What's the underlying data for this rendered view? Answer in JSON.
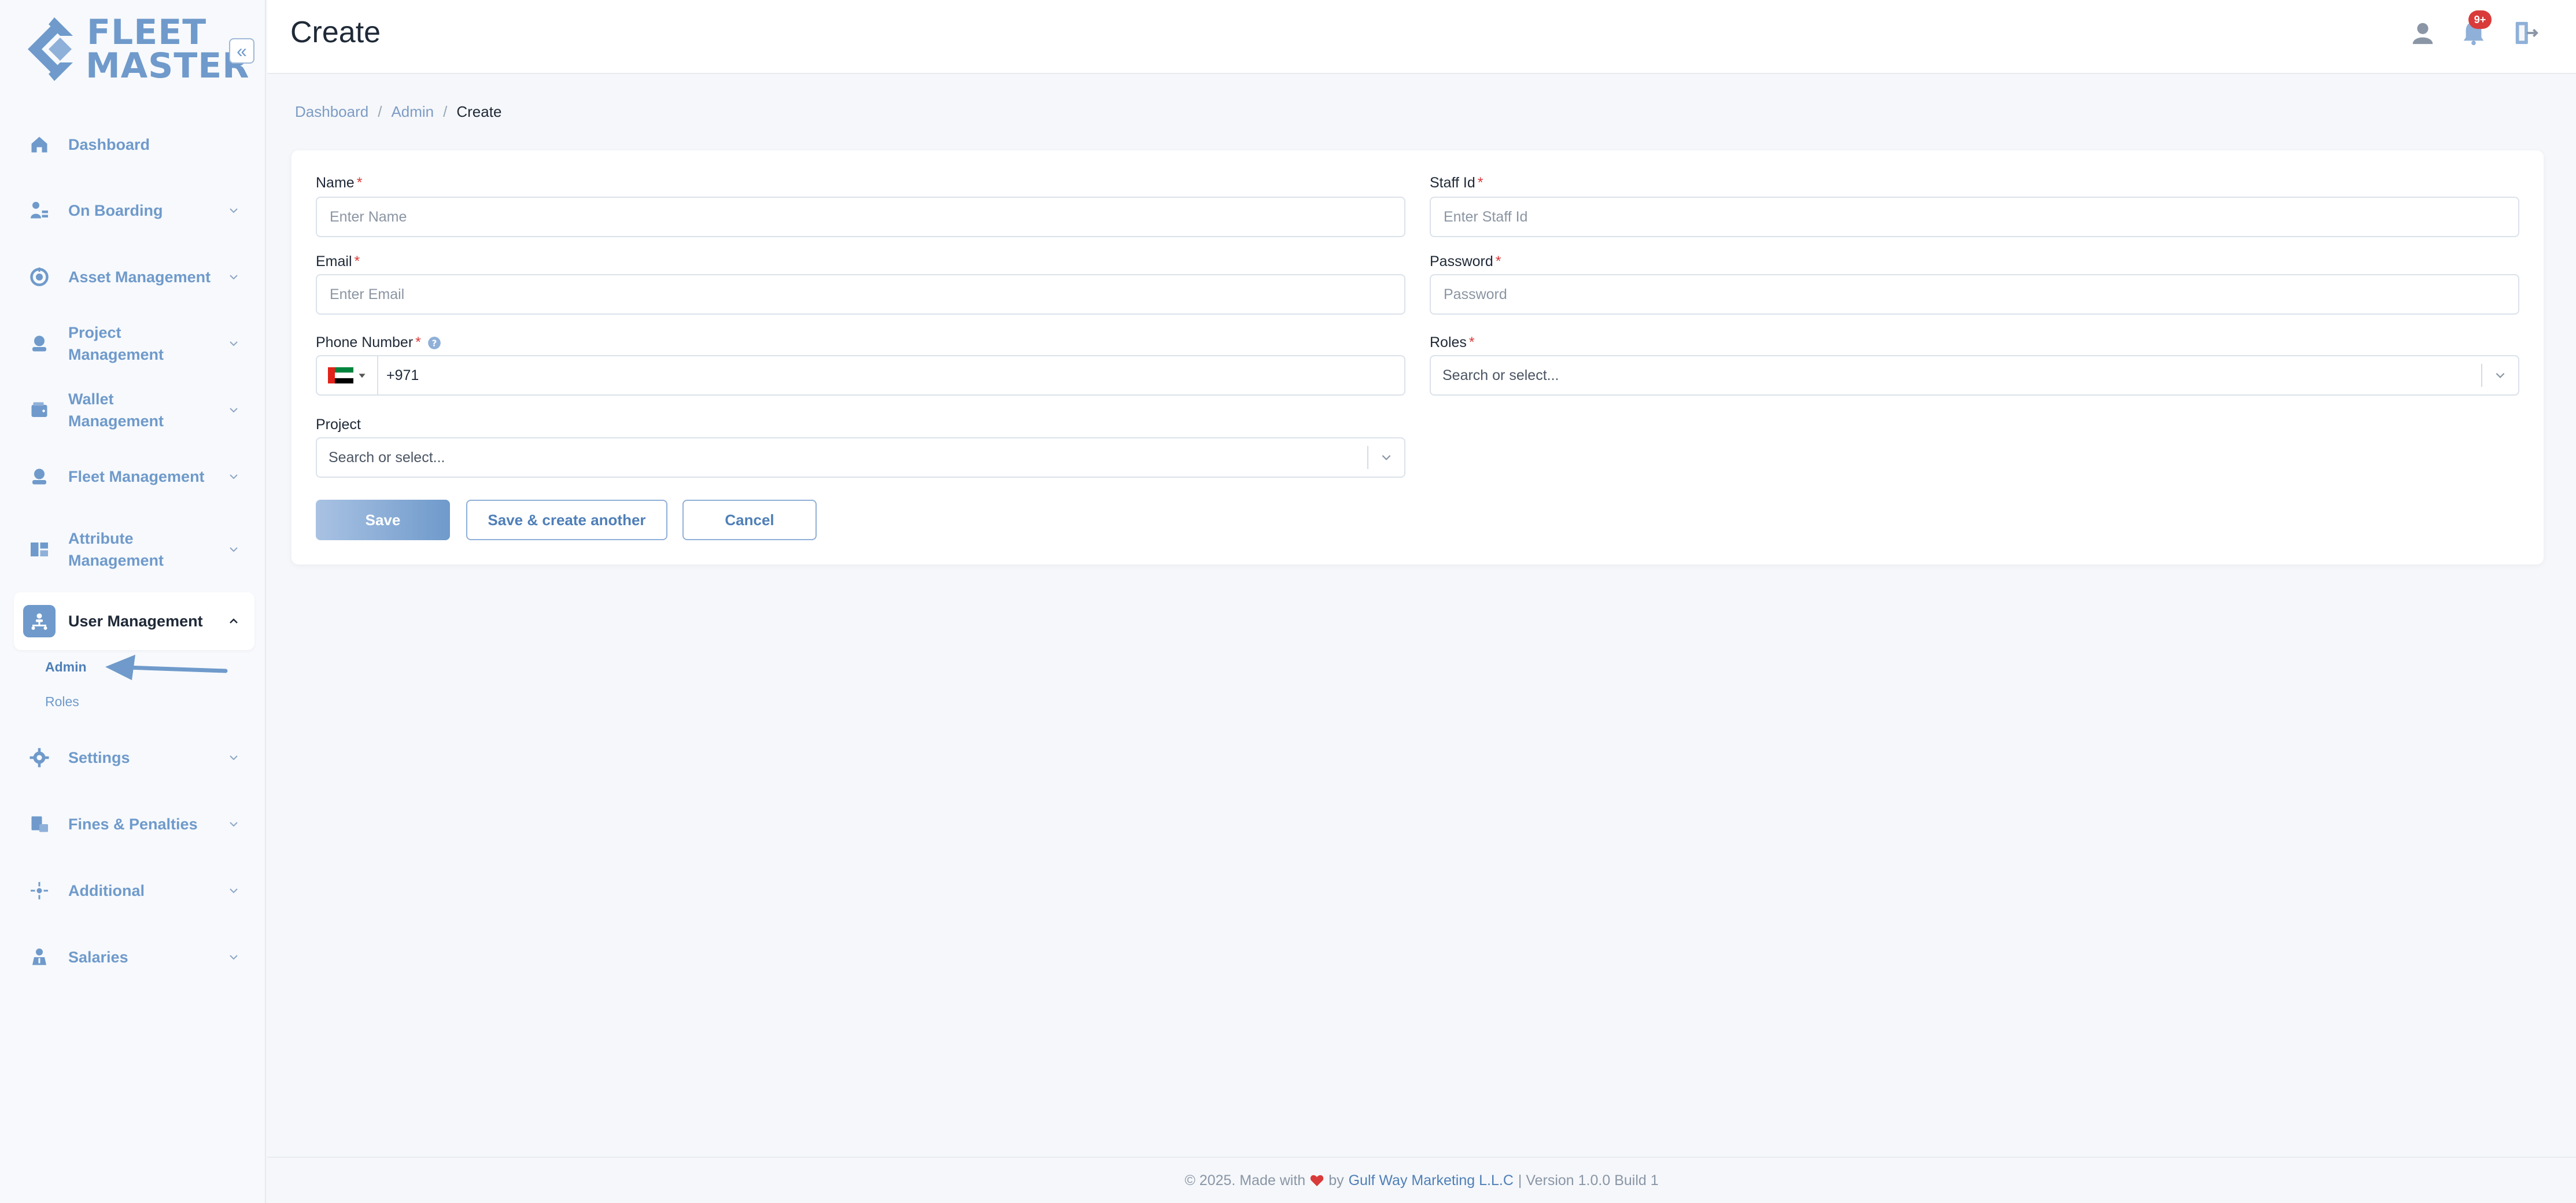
{
  "app": {
    "logo_line1": "FLEET",
    "logo_line2": "MASTER",
    "collapse_icon": "«"
  },
  "sidebar": {
    "items": [
      {
        "label": "Dashboard",
        "icon": "home-icon"
      },
      {
        "label": "On Boarding",
        "icon": "onboarding-icon"
      },
      {
        "label": "Asset Management",
        "icon": "asset-icon"
      },
      {
        "label": "Project Management",
        "icon": "project-icon"
      },
      {
        "label": "Wallet Management",
        "icon": "wallet-icon"
      },
      {
        "label": "Fleet Management",
        "icon": "fleet-icon"
      },
      {
        "label": "Attribute Management",
        "icon": "attribute-icon"
      },
      {
        "label": "User Management",
        "icon": "user-management-icon"
      },
      {
        "label": "Settings",
        "icon": "settings-icon"
      },
      {
        "label": "Fines & Penalties",
        "icon": "fines-icon"
      },
      {
        "label": "Additional",
        "icon": "additional-icon"
      },
      {
        "label": "Salaries",
        "icon": "salaries-icon"
      }
    ],
    "sub_items": [
      {
        "label": "Admin",
        "active": true
      },
      {
        "label": "Roles",
        "active": false
      }
    ]
  },
  "header": {
    "title": "Create",
    "notification_badge": "9+"
  },
  "breadcrumb": {
    "items": [
      "Dashboard",
      "Admin",
      "Create"
    ],
    "separator": "/"
  },
  "form": {
    "name": {
      "label": "Name",
      "placeholder": "Enter Name",
      "required": "*"
    },
    "staff_id": {
      "label": "Staff Id",
      "placeholder": "Enter Staff Id",
      "required": "*"
    },
    "email": {
      "label": "Email",
      "placeholder": "Enter Email",
      "required": "*"
    },
    "password": {
      "label": "Password",
      "placeholder": "Password",
      "required": "*"
    },
    "phone": {
      "label": "Phone Number",
      "value": "+971",
      "required": "*",
      "country": "UAE"
    },
    "roles": {
      "label": "Roles",
      "placeholder": "Search or select...",
      "required": "*"
    },
    "project": {
      "label": "Project",
      "placeholder": "Search or select..."
    },
    "buttons": {
      "save": "Save",
      "save_another": "Save & create another",
      "cancel": "Cancel"
    }
  },
  "footer": {
    "prefix": "© 2025. Made with",
    "by": "by",
    "company": "Gulf Way Marketing L.L.C",
    "version": "| Version 1.0.0 Build 1"
  },
  "colors": {
    "accent": "#6f9acb",
    "required": "#d93b3b",
    "badge": "#d93b3b"
  }
}
